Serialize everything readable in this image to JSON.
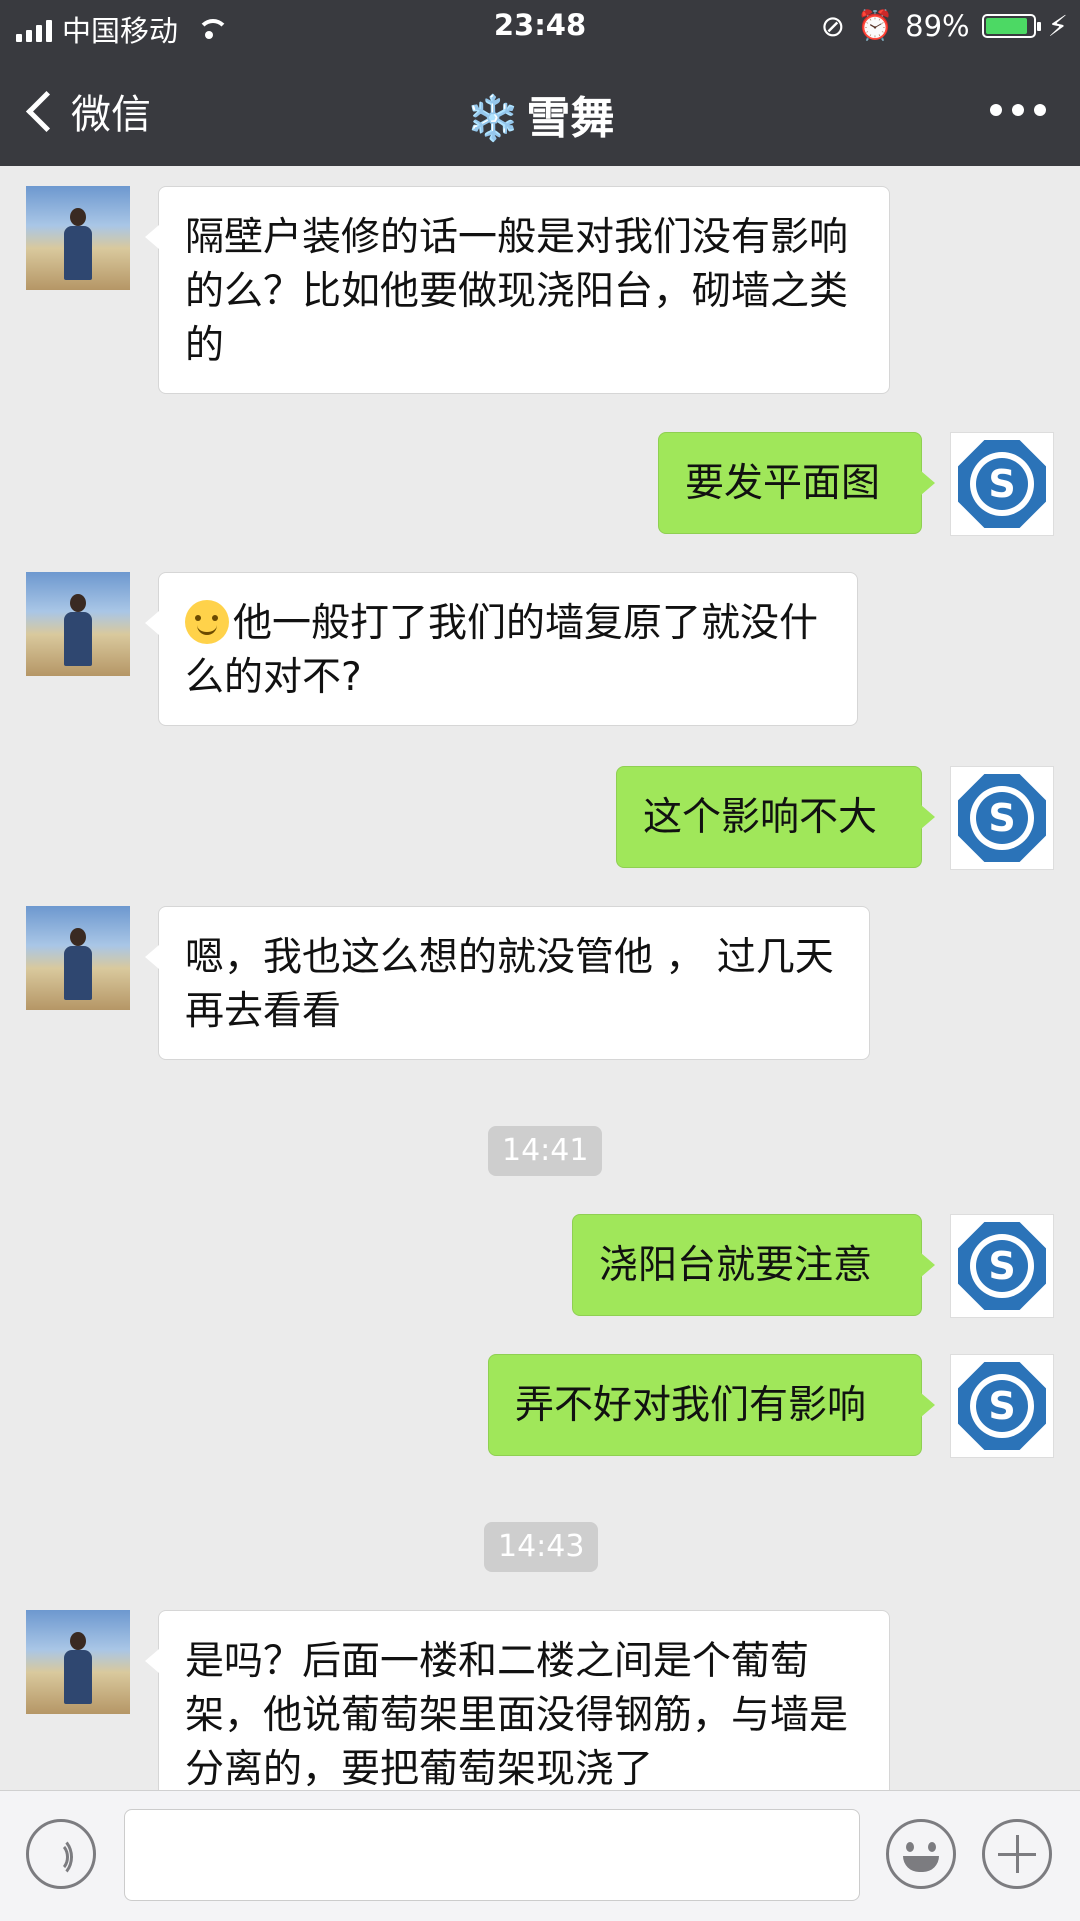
{
  "status_bar": {
    "carrier": "中国移动",
    "time": "23:48",
    "battery_percent": "89%",
    "battery_level": 0.89,
    "battery_color": "#4cd964",
    "icons": [
      "signal-icon",
      "wifi-icon",
      "rotation-lock-icon",
      "alarm-icon",
      "battery-icon",
      "charging-icon"
    ]
  },
  "nav": {
    "back_label": "微信",
    "title_emoji": "❄️",
    "title": "雪舞",
    "more_icon": "more-dots-icon"
  },
  "messages": [
    {
      "side": "in",
      "text": "隔壁户装修的话一般是对我们没有影响的么？比如他要做现浇阳台，砌墙之类的"
    },
    {
      "side": "out",
      "text": "要发平面图"
    },
    {
      "side": "in",
      "emoji": "smile-emoji",
      "text": "他一般打了我们的墙复原了就没什么的对不?"
    },
    {
      "side": "out",
      "text": "这个影响不大"
    },
    {
      "side": "in",
      "text": "嗯，我也这么想的就没管他 ， 过几天再去看看"
    },
    {
      "timestamp": "14:41"
    },
    {
      "side": "out",
      "text": "浇阳台就要注意"
    },
    {
      "side": "out",
      "text": "弄不好对我们有影响"
    },
    {
      "timestamp": "14:43"
    },
    {
      "side": "in",
      "text": "是吗？后面一楼和二楼之间是个葡萄架，他说葡萄架里面没得钢筋，与墙是分离的，要把葡萄架现浇了"
    }
  ],
  "colors": {
    "bar_bg": "#393a3f",
    "chat_bg": "#ebebeb",
    "outgoing_bubble": "#a0e75a",
    "incoming_bubble": "#ffffff"
  },
  "input_bar": {
    "text": "",
    "icons": [
      "voice-icon",
      "emoji-icon",
      "plus-icon"
    ]
  }
}
